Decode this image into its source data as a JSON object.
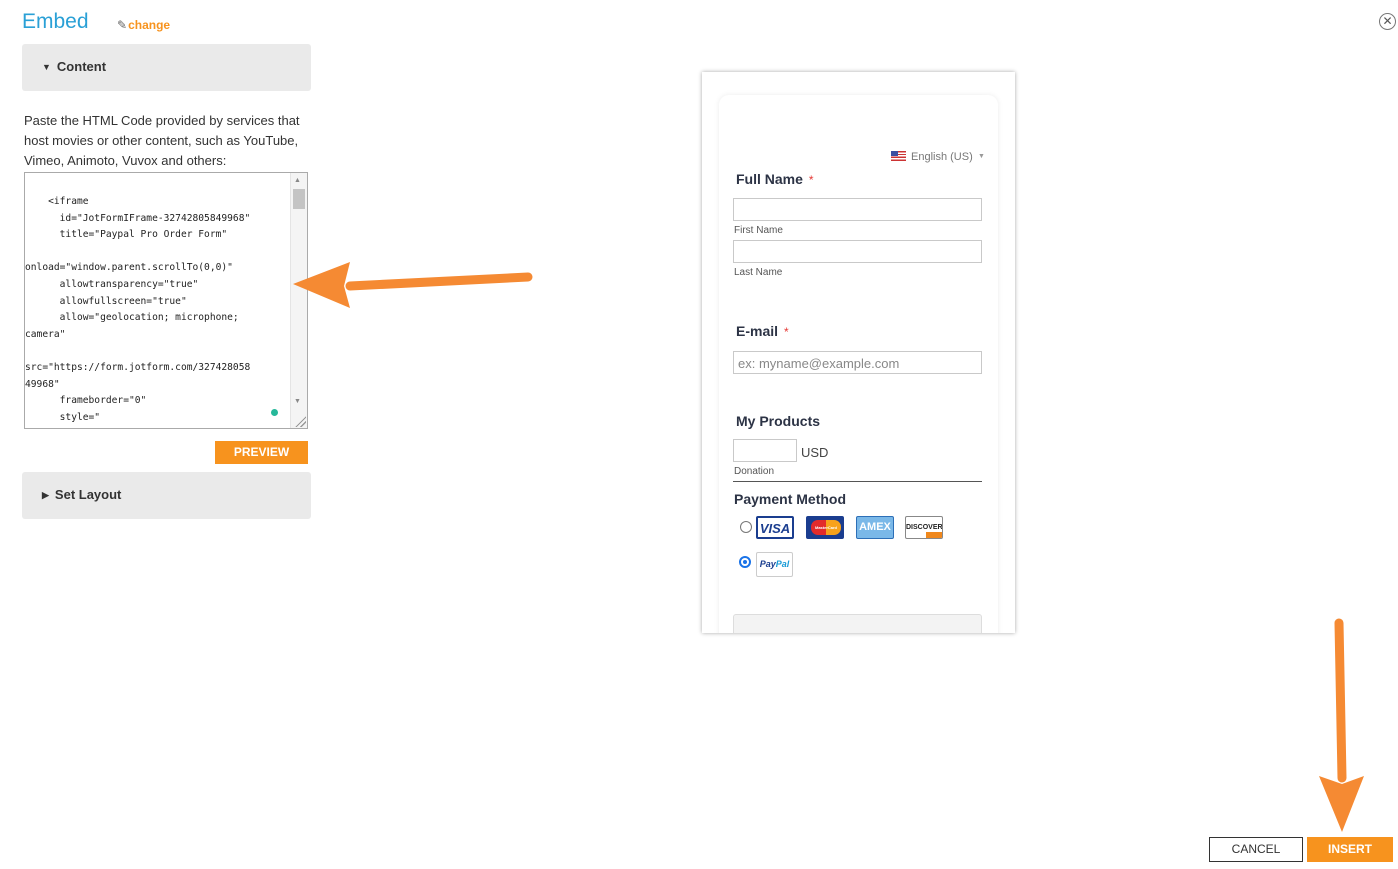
{
  "header": {
    "title": "Embed",
    "change_label": "change",
    "pencil_icon": "pencil-icon",
    "close_icon": "close-circle-icon"
  },
  "content_section": {
    "label": "Content",
    "description": "Paste the HTML Code provided by services that host movies or other content, such as YouTube, Vimeo, Animoto, Vuvox and others:",
    "code": "    <iframe\n      id=\"JotFormIFrame-32742805849968\"\n      title=\"Paypal Pro Order Form\"\n\nonload=\"window.parent.scrollTo(0,0)\"\n      allowtransparency=\"true\"\n      allowfullscreen=\"true\"\n      allow=\"geolocation; microphone;\ncamera\"\n\nsrc=\"https://form.jotform.com/327428058\n49968\"\n      frameborder=\"0\"\n      style=\"",
    "preview_label": "PREVIEW"
  },
  "layout_section": {
    "label": "Set Layout"
  },
  "form_preview": {
    "language": "English (US)",
    "full_name_label": "Full Name",
    "required_mark": "*",
    "first_name_sublabel": "First Name",
    "last_name_sublabel": "Last Name",
    "email_label": "E-mail",
    "email_placeholder": "ex: myname@example.com",
    "products_label": "My Products",
    "currency": "USD",
    "donation_sublabel": "Donation",
    "payment_label": "Payment Method",
    "card_visa": "VISA",
    "card_mastercard": "MasterCard",
    "card_amex": "AMEX",
    "card_discover": "DISCOVER",
    "paypal_pay": "Pay",
    "paypal_pal": "Pal"
  },
  "footer": {
    "cancel_label": "CANCEL",
    "insert_label": "INSERT"
  },
  "colors": {
    "accent_orange": "#f7931e",
    "title_blue": "#2aa0d6",
    "arrow_orange": "#f58a33"
  }
}
